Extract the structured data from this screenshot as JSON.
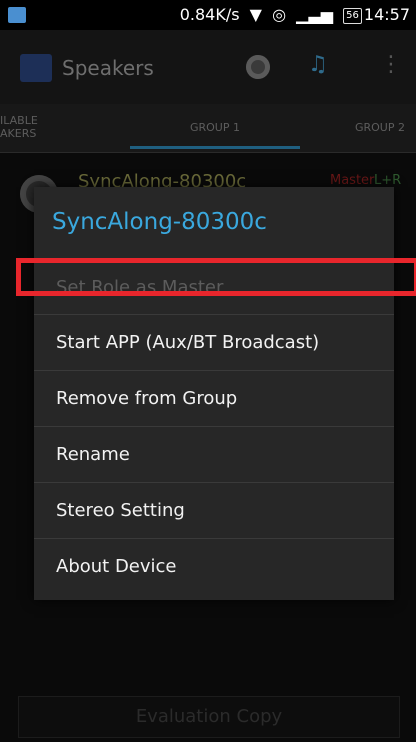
{
  "status_bar": {
    "network_speed": "0.84K/s",
    "battery": "56",
    "time": "14:57"
  },
  "action_bar": {
    "title": "Speakers"
  },
  "tabs": [
    {
      "label_line1": "ILABLE",
      "label_line2": "AKERS"
    },
    {
      "label": "GROUP 1"
    },
    {
      "label": "GROUP 2"
    }
  ],
  "background_list": {
    "item_name": "SyncAlong-80300c",
    "item_status": "Master",
    "item_channel": "L+R"
  },
  "evaluation_label": "Evaluation Copy",
  "dialog": {
    "title": "SyncAlong-80300c",
    "items": [
      {
        "label": "Set Role as Master",
        "enabled": false
      },
      {
        "label": "Start APP (Aux/BT Broadcast)",
        "enabled": true
      },
      {
        "label": "Remove from Group",
        "enabled": true
      },
      {
        "label": "Rename",
        "enabled": true
      },
      {
        "label": "Stereo Setting",
        "enabled": true
      },
      {
        "label": "About Device",
        "enabled": true
      }
    ]
  },
  "colors": {
    "accent": "#3aa8de",
    "highlight": "#e8262c"
  }
}
